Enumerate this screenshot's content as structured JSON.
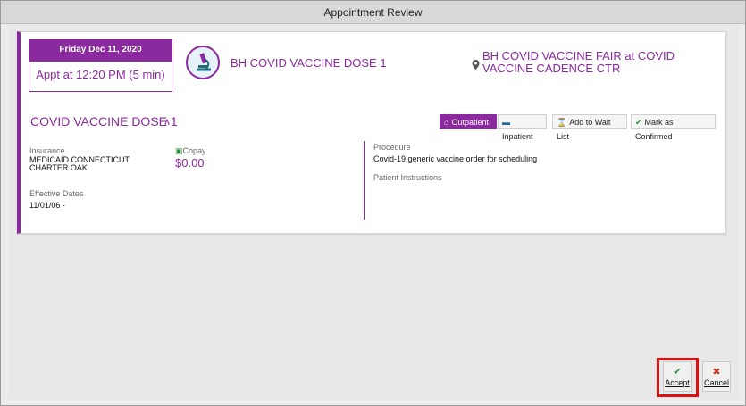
{
  "window": {
    "title": "Appointment Review"
  },
  "appointment": {
    "date": "Friday Dec 11, 2020",
    "time": "Appt at 12:20 PM (5 min)",
    "visit_type": "BH COVID VACCINE DOSE 1",
    "location_line1": "BH COVID VACCINE FAIR at COVID",
    "location_line2": "VACCINE CADENCE CTR",
    "procedure_title": "COVID VACCINE DOSE 1"
  },
  "actions": {
    "outpatient": "Outpatient",
    "inpatient": "Inpatient",
    "wait_list": "Add to Wait List",
    "confirm": "Mark as Confirmed"
  },
  "details": {
    "insurance_label": "Insurance",
    "insurance_line1": "MEDICAID CONNECTICUT",
    "insurance_line2": "CHARTER OAK",
    "copay_label": "Copay",
    "copay_value": "$0.00",
    "effective_label": "Effective Dates",
    "effective_value": "11/01/06 -",
    "procedure_label": "Procedure",
    "procedure_value": "Covid-19 generic vaccine order for scheduling",
    "instructions_label": "Patient Instructions"
  },
  "footer": {
    "accept": "Accept",
    "cancel": "Cancel"
  },
  "colors": {
    "accent": "#8a2a9e",
    "highlight": "#e01010",
    "accept_check": "#2e8b3a",
    "cancel_x": "#c0392b"
  },
  "icons": [
    "microscope-icon",
    "location-pin-icon",
    "chevron-up-icon",
    "home-icon",
    "bed-icon",
    "hourglass-icon",
    "check-circle-icon",
    "money-icon",
    "check-icon",
    "x-icon"
  ]
}
